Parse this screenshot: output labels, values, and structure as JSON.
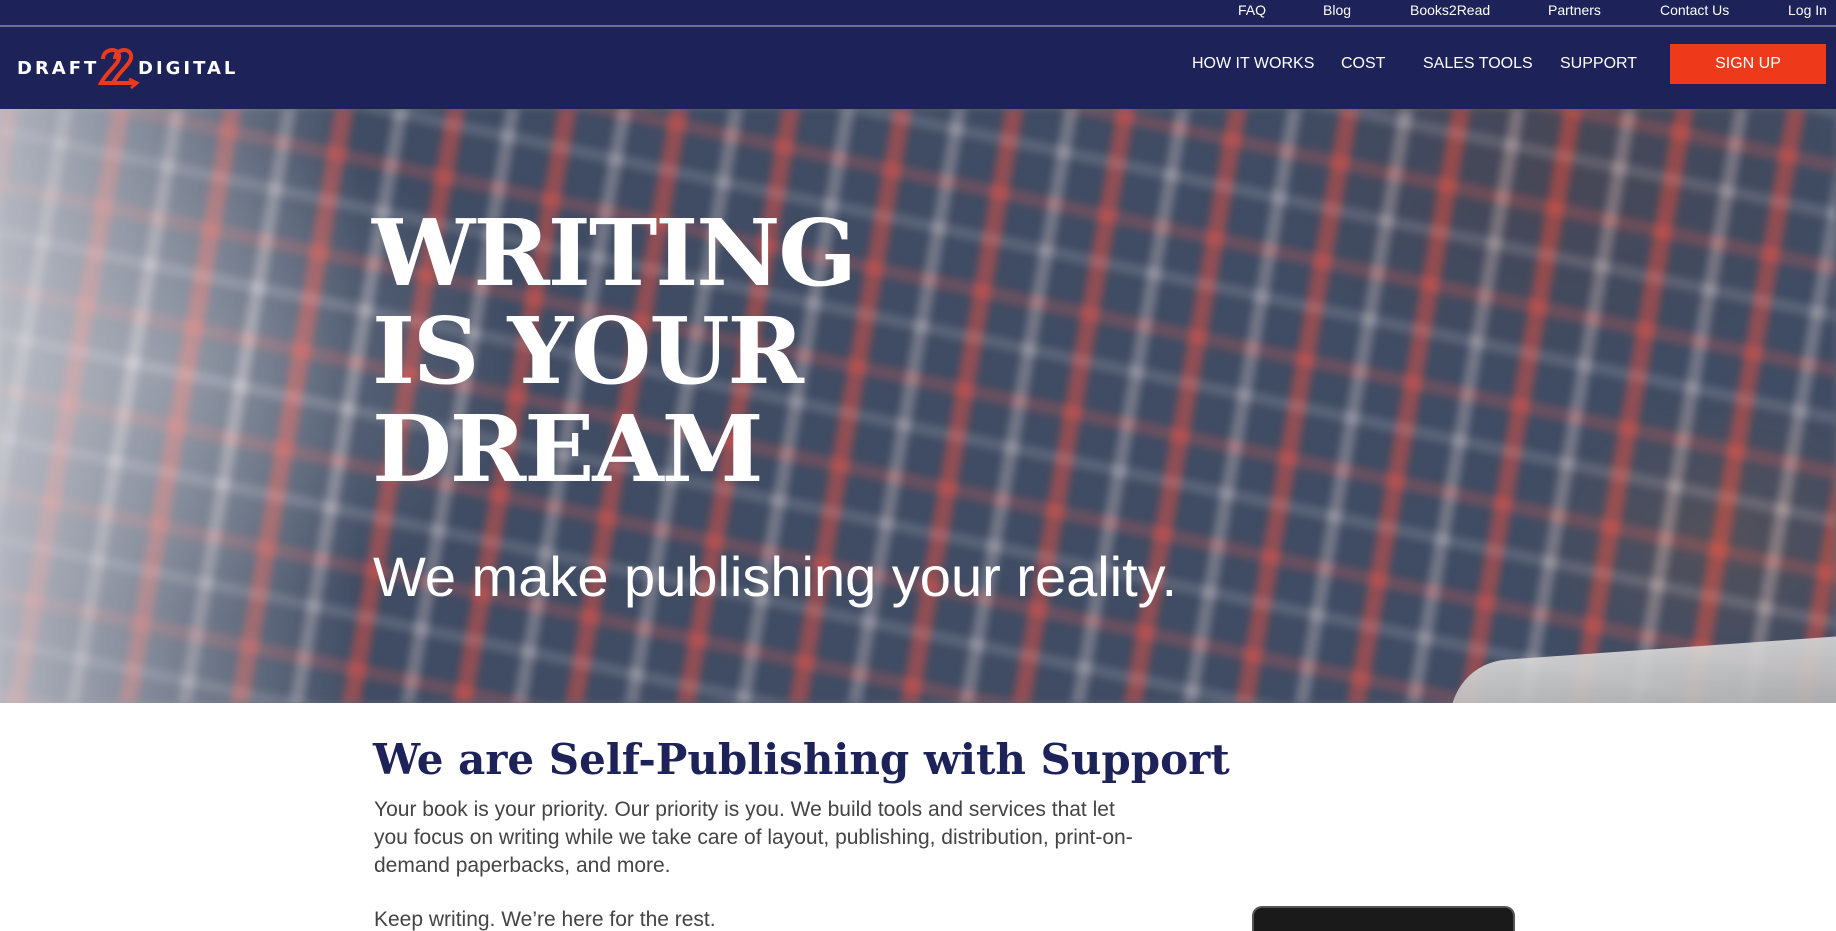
{
  "utility_nav": {
    "items": [
      {
        "id": "faq",
        "label": "FAQ"
      },
      {
        "id": "blog",
        "label": "Blog"
      },
      {
        "id": "books2read",
        "label": "Books2Read"
      },
      {
        "id": "partners",
        "label": "Partners"
      },
      {
        "id": "contact",
        "label": "Contact Us"
      },
      {
        "id": "login",
        "label": "Log In"
      }
    ]
  },
  "header": {
    "logo": {
      "left_text": "DRAFT",
      "numeral": "2",
      "right_text": "DIGITAL"
    },
    "nav": [
      {
        "id": "how",
        "label": "HOW IT WORKS"
      },
      {
        "id": "cost",
        "label": "COST"
      },
      {
        "id": "tools",
        "label": "SALES TOOLS"
      },
      {
        "id": "support",
        "label": "SUPPORT"
      }
    ],
    "signup_label": "SIGN UP"
  },
  "hero": {
    "title": "WRITING\nIS YOUR\nDREAM",
    "subtitle": "We make publishing your reality."
  },
  "intro": {
    "title": "We are Self-Publishing with Support",
    "body": "Your book is your priority. Our priority is you. We build tools and services that let you focus on writing while we take care of layout, publishing, distribution, print-on-demand paperbacks, and more.",
    "tagline": "Keep writing. We’re here for the rest."
  },
  "colors": {
    "navy": "#1d2259",
    "accent": "#ee3a1b",
    "body_text": "#444444"
  }
}
